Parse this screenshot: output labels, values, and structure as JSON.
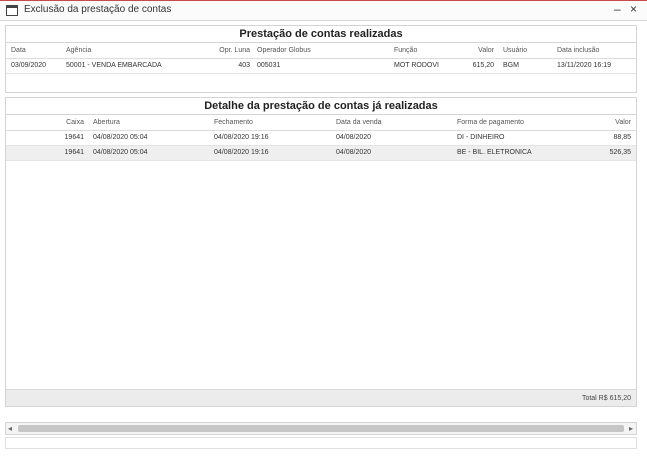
{
  "window": {
    "title": "Exclusão da prestação de contas",
    "minimize_label": "–",
    "close_label": "×"
  },
  "panel1": {
    "title": "Prestação de contas realizadas",
    "columns": [
      "Data",
      "Agência",
      "Opr. Luna",
      "Operador Globus",
      "Função",
      "Valor",
      "Usuário",
      "Data inclusão"
    ],
    "rows": [
      [
        "03/09/2020",
        "50001 - VENDA EMBARCADA",
        "403",
        "005031",
        "MOT RODOVI",
        "615,20",
        "BGM",
        "13/11/2020 16:19"
      ]
    ]
  },
  "panel2": {
    "title": "Detalhe da prestação de contas já realizadas",
    "columns": [
      "Caixa",
      "Abertura",
      "Fechamento",
      "Data da venda",
      "Forma de pagamento",
      "Valor"
    ],
    "rows": [
      [
        "19641",
        "04/08/2020 05:04",
        "04/08/2020 19:16",
        "04/08/2020",
        "DI - DINHEIRO",
        "88,85"
      ],
      [
        "19641",
        "04/08/2020 05:04",
        "04/08/2020 19:16",
        "04/08/2020",
        "BE - BIL. ELETRONICA",
        "526,35"
      ]
    ],
    "total": "Total R$ 615,20"
  },
  "scrollbar": {
    "left_arrow": "◂",
    "right_arrow": "▸"
  }
}
